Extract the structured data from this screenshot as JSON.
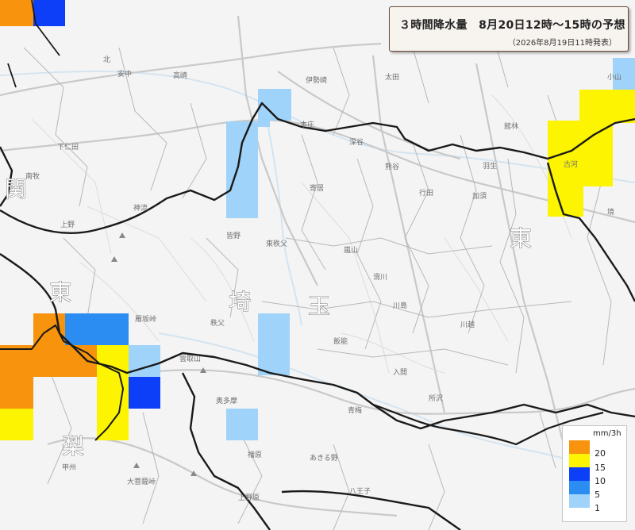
{
  "header": {
    "title": "３時間降水量　8月20日12時〜15時の予想",
    "issued": "（2026年8月19日11時発表）"
  },
  "legend": {
    "unit": "mm/3h",
    "items": [
      {
        "label": "20",
        "color": "#f7930c"
      },
      {
        "label": "15",
        "color": "#fcf400"
      },
      {
        "label": "10",
        "color": "#0c3ff7"
      },
      {
        "label": "5",
        "color": "#2b8cf2"
      },
      {
        "label": "1",
        "color": "#a0d3f9"
      }
    ]
  },
  "colors": {
    "very_heavy": "#f7930c",
    "heavy": "#fcf400",
    "strong": "#0c3ff7",
    "moderate": "#2b8cf2",
    "light": "#a0d3f9",
    "prefecture_border": "#1a1a1a",
    "municipal_border": "#b5b5b5",
    "road": "#c4c4c4"
  },
  "map": {
    "region_labels": [
      "関",
      "東",
      "埼",
      "玉",
      "東",
      "梨"
    ],
    "place_labels": [
      "安中",
      "北",
      "下仁田",
      "南牧",
      "上野",
      "神流",
      "皆野",
      "東秩父",
      "秩父",
      "本庄",
      "深谷",
      "寄居",
      "熊谷",
      "行田",
      "羽生",
      "加須",
      "太田",
      "嵐山",
      "滑川",
      "川島",
      "川越",
      "入間",
      "所沢",
      "飯能",
      "奥多摩",
      "檜原",
      "あきる野",
      "八王子",
      "青梅",
      "小山",
      "古河",
      "境",
      "雲取山",
      "雁坂峠",
      "大菩薩峠",
      "甲州",
      "上野原",
      "高崎",
      "伊勢崎",
      "館林"
    ]
  }
}
